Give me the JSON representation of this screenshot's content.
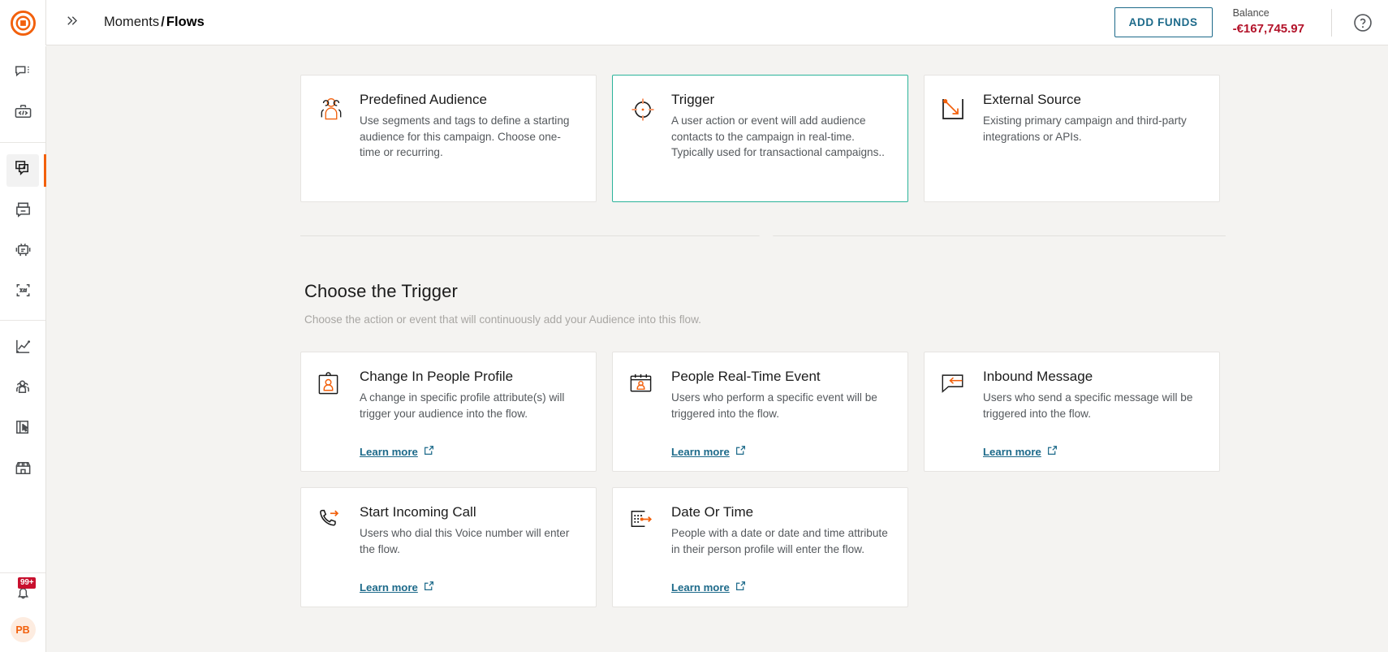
{
  "topbar": {
    "collapse_icon": "double-chevron-right-icon",
    "breadcrumb_parent": "Moments",
    "breadcrumb_separator": "/",
    "breadcrumb_current": "Flows",
    "add_funds_label": "ADD FUNDS",
    "balance_label": "Balance",
    "balance_value": "-€167,745.97",
    "help_icon": "help-circle-icon",
    "accent_color": "#f2600c",
    "link_color": "#1d6a8a",
    "balance_color": "#b3132a"
  },
  "sidebar": {
    "logo_icon": "infobip-logo-icon",
    "groups": [
      {
        "items": [
          {
            "icon": "conversations-icon",
            "name": "conversations"
          },
          {
            "icon": "developer-tools-icon",
            "name": "developer-tools"
          }
        ]
      },
      {
        "items": [
          {
            "icon": "moments-flows-icon",
            "name": "moments",
            "active": true
          },
          {
            "icon": "broadcast-icon",
            "name": "broadcast"
          },
          {
            "icon": "answers-bot-icon",
            "name": "answers"
          },
          {
            "icon": "numbers-icon",
            "name": "numbers"
          }
        ]
      },
      {
        "items": [
          {
            "icon": "analytics-chart-icon",
            "name": "analytics"
          },
          {
            "icon": "people-icon",
            "name": "people"
          },
          {
            "icon": "forms-icon",
            "name": "forms"
          },
          {
            "icon": "storefront-icon",
            "name": "exchange"
          }
        ]
      }
    ],
    "notifications": {
      "icon": "bell-icon",
      "badge": "99+",
      "badge_color": "#c8102e"
    },
    "avatar_initials": "PB"
  },
  "entry_point_cards": [
    {
      "icon": "predefined-audience-icon",
      "title": "Predefined Audience",
      "description": "Use segments and tags to define a starting audience for this campaign. Choose one-time or recurring.",
      "selected": false
    },
    {
      "icon": "trigger-target-icon",
      "title": "Trigger",
      "description": "A user action or event will add audience contacts to the campaign in real-time. Typically used for transactional campaigns..",
      "selected": true
    },
    {
      "icon": "external-source-icon",
      "title": "External Source",
      "description": "Existing primary campaign and third-party integrations or APIs.",
      "selected": false
    }
  ],
  "section": {
    "title": "Choose the Trigger",
    "subtitle": "Choose the action or event that will continuously add your Audience into this flow."
  },
  "trigger_cards": [
    {
      "icon": "profile-badge-icon",
      "title": "Change In People Profile",
      "description": "A change in specific profile attribute(s) will trigger your audience into the flow.",
      "learn_more": "Learn more",
      "learn_more_icon": "external-link-icon"
    },
    {
      "icon": "calendar-person-icon",
      "title": "People Real-Time Event",
      "description": "Users who perform a specific event will be triggered into the flow.",
      "learn_more": "Learn more",
      "learn_more_icon": "external-link-icon"
    },
    {
      "icon": "inbound-message-icon",
      "title": "Inbound Message",
      "description": "Users who send a specific message will be triggered into the flow.",
      "learn_more": "Learn more",
      "learn_more_icon": "external-link-icon"
    },
    {
      "icon": "incoming-call-icon",
      "title": "Start Incoming Call",
      "description": "Users who dial this Voice number will enter the flow.",
      "learn_more": "Learn more",
      "learn_more_icon": "external-link-icon"
    },
    {
      "icon": "date-time-icon",
      "title": "Date Or Time",
      "description": "People with a date or date and time attribute in their person profile will enter the flow.",
      "learn_more": "Learn more",
      "learn_more_icon": "external-link-icon"
    }
  ]
}
